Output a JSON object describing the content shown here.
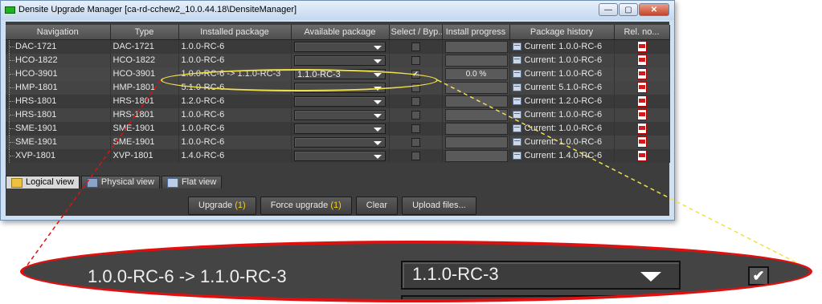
{
  "window": {
    "title": "Densite Upgrade Manager [ca-rd-cchew2_10.0.44.18\\DensiteManager]",
    "buttons": {
      "minimize": "—",
      "maximize": "▢",
      "close": "✕"
    }
  },
  "table": {
    "headers": [
      "Navigation",
      "Type",
      "Installed package",
      "Available package",
      "Select / Byp...",
      "Install progress",
      "Package history",
      "Rel. no..."
    ],
    "rows": [
      {
        "nav": "DAC-1721",
        "type": "DAC-1721",
        "installed": "1.0.0-RC-6",
        "available": "",
        "checked": false,
        "progress": "",
        "history": "Current: 1.0.0-RC-6"
      },
      {
        "nav": "HCO-1822",
        "type": "HCO-1822",
        "installed": "1.0.0-RC-6",
        "available": "",
        "checked": false,
        "progress": "",
        "history": "Current: 1.0.0-RC-6"
      },
      {
        "nav": "HCO-3901",
        "type": "HCO-3901",
        "installed": "1.0.0-RC-6 -> 1.1.0-RC-3",
        "available": "1.1.0-RC-3",
        "checked": true,
        "progress": "0.0 %",
        "history": "Current: 1.0.0-RC-6"
      },
      {
        "nav": "HMP-1801",
        "type": "HMP-1801",
        "installed": "5.1.0-RC-6",
        "available": "",
        "checked": false,
        "progress": "",
        "history": "Current: 5.1.0-RC-6"
      },
      {
        "nav": "HRS-1801",
        "type": "HRS-1801",
        "installed": "1.2.0-RC-6",
        "available": "",
        "checked": false,
        "progress": "",
        "history": "Current: 1.2.0-RC-6"
      },
      {
        "nav": "HRS-1801",
        "type": "HRS-1801",
        "installed": "1.0.0-RC-6",
        "available": "",
        "checked": false,
        "progress": "",
        "history": "Current: 1.0.0-RC-6"
      },
      {
        "nav": "SME-1901",
        "type": "SME-1901",
        "installed": "1.0.0-RC-6",
        "available": "",
        "checked": false,
        "progress": "",
        "history": "Current: 1.0.0-RC-6"
      },
      {
        "nav": "SME-1901",
        "type": "SME-1901",
        "installed": "1.0.0-RC-6",
        "available": "",
        "checked": false,
        "progress": "",
        "history": "Current: 1.0.0-RC-6"
      },
      {
        "nav": "XVP-1801",
        "type": "XVP-1801",
        "installed": "1.4.0-RC-6",
        "available": "",
        "checked": false,
        "progress": "",
        "history": "Current: 1.4.0-RC-6"
      }
    ]
  },
  "tabs": [
    "Logical view",
    "Physical view",
    "Flat view"
  ],
  "actions": {
    "upgrade": "Upgrade",
    "upgrade_count": "(1)",
    "force_upgrade": "Force upgrade",
    "force_count": "(1)",
    "clear": "Clear",
    "upload": "Upload files..."
  },
  "callout": {
    "installed": "1.0.0-RC-6 -> 1.1.0-RC-3",
    "available": "1.1.0-RC-3",
    "check": "✔"
  },
  "colors": {
    "highlight_ring": "#f0e04a",
    "callout_border": "#e01010",
    "count_accent": "#f5d21a"
  }
}
